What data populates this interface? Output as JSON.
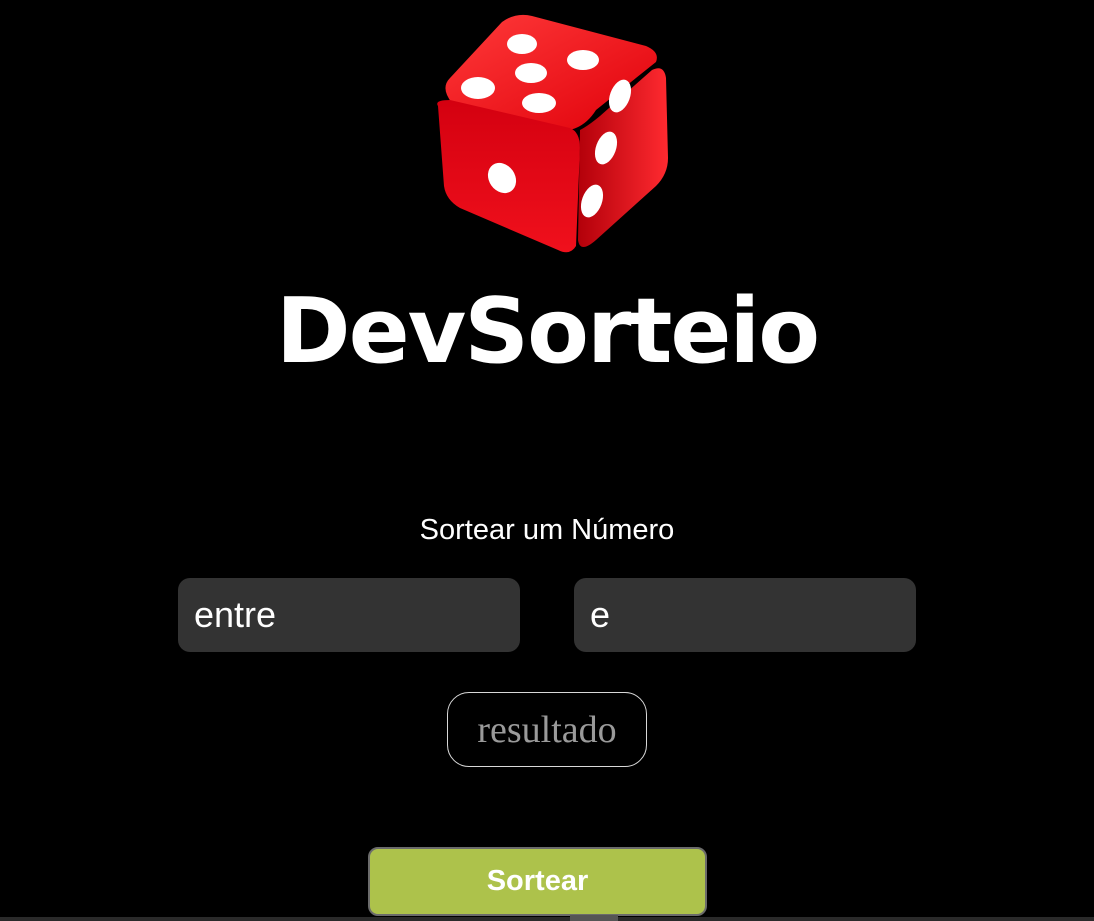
{
  "app": {
    "title": "DevSorteio",
    "subtitle": "Sortear um Número"
  },
  "form": {
    "min_placeholder": "entre",
    "max_placeholder": "e",
    "result_text": "resultado",
    "button_label": "Sortear"
  },
  "logo": {
    "icon": "red-dice-icon"
  },
  "colors": {
    "background": "#000000",
    "input_bg": "#333333",
    "button_bg": "#adc24b",
    "dice_red": "#e30613"
  }
}
